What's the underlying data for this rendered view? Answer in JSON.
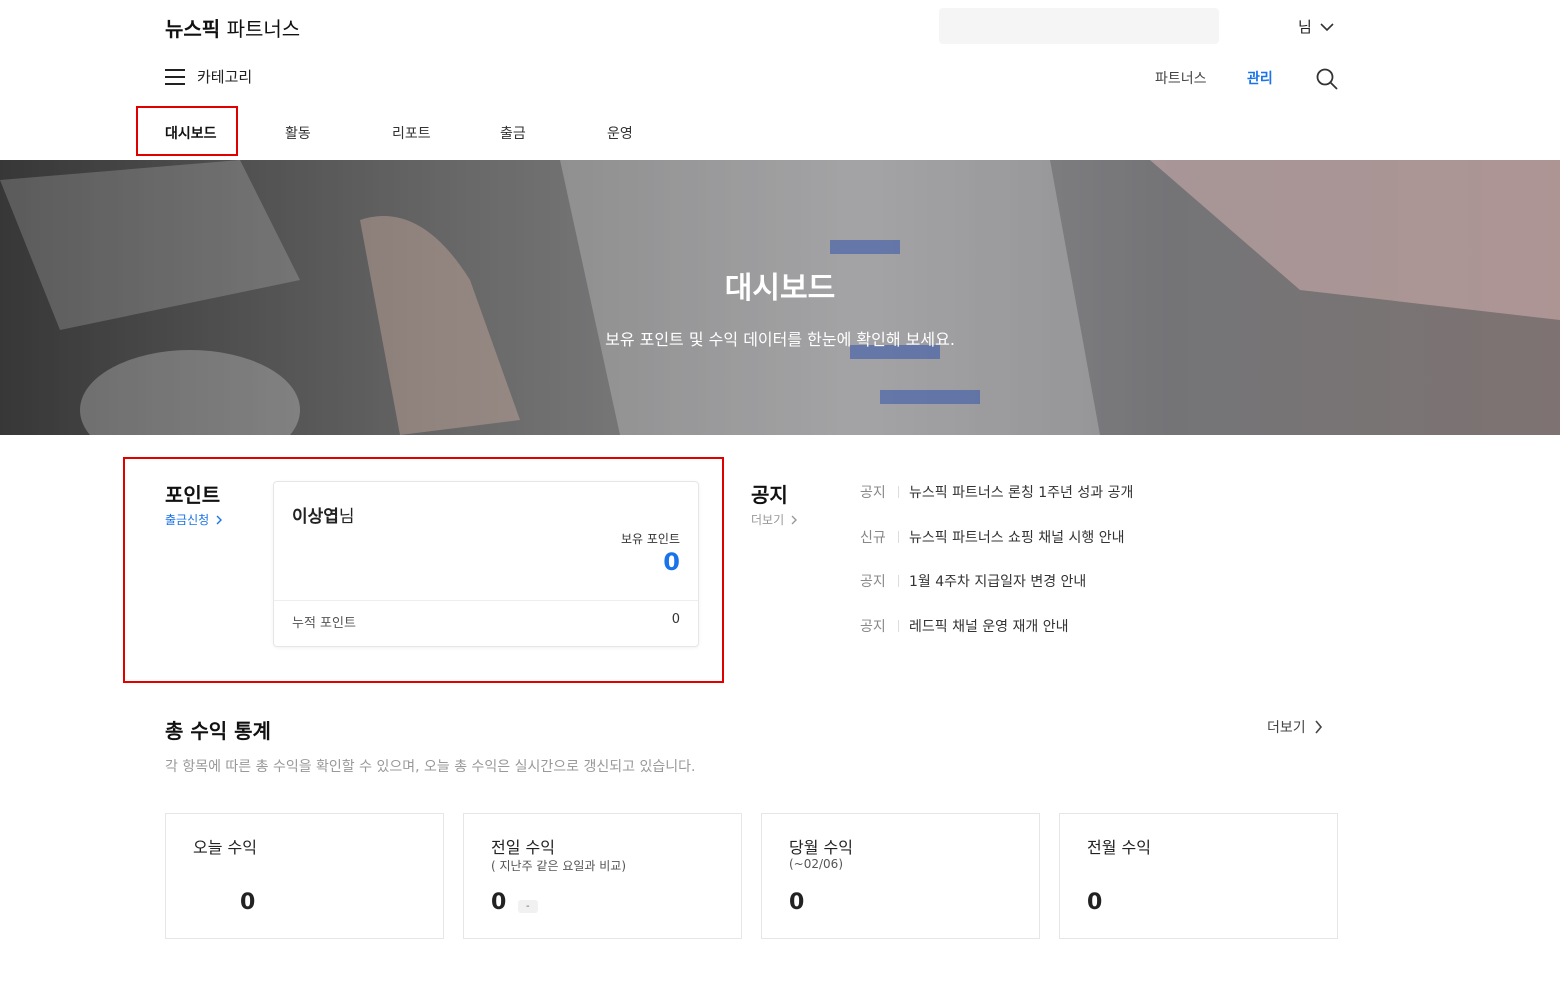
{
  "header": {
    "logo_bold": "뉴스픽",
    "logo_rest": "파트너스",
    "user_label": "님",
    "category_label": "카테고리",
    "nav_links": [
      "파트너스",
      "관리"
    ]
  },
  "tabs": [
    "대시보드",
    "활동",
    "리포트",
    "출금",
    "운영"
  ],
  "hero": {
    "title": "대시보드",
    "subtitle": "보유 포인트 및 수익 데이터를 한눈에 확인해 보세요."
  },
  "points": {
    "title": "포인트",
    "withdraw_link": "출금신청",
    "user_name": "이상엽",
    "user_suffix": "님",
    "holding_label": "보유 포인트",
    "holding_value": "0",
    "cumulative_label": "누적 포인트",
    "cumulative_value": "0"
  },
  "notices": {
    "title": "공지",
    "more": "더보기",
    "items": [
      {
        "tag": "공지",
        "title": "뉴스픽 파트너스 론칭 1주년 성과 공개"
      },
      {
        "tag": "신규",
        "title": "뉴스픽 파트너스 쇼핑 채널 시행 안내"
      },
      {
        "tag": "공지",
        "title": "1월 4주차 지급일자 변경 안내"
      },
      {
        "tag": "공지",
        "title": "레드픽 채널 운영 재개 안내"
      }
    ]
  },
  "earnings": {
    "title": "총 수익 통계",
    "more": "더보기",
    "description": "각 항목에 따른 총 수익을 확인할 수 있으며, 오늘 총 수익은 실시간으로 갱신되고 있습니다.",
    "cards": [
      {
        "label": "오늘 수익",
        "sub": "",
        "value": "0"
      },
      {
        "label": "전일 수익",
        "sub": "( 지난주 같은 요일과 비교)",
        "value": "0",
        "badge": "-"
      },
      {
        "label": "당월 수익",
        "sub": "(~02/06)",
        "value": "0"
      },
      {
        "label": "전월 수익",
        "sub": "",
        "value": "0"
      }
    ]
  },
  "colors": {
    "accent": "#1a73e8",
    "highlight": "#e00000"
  }
}
